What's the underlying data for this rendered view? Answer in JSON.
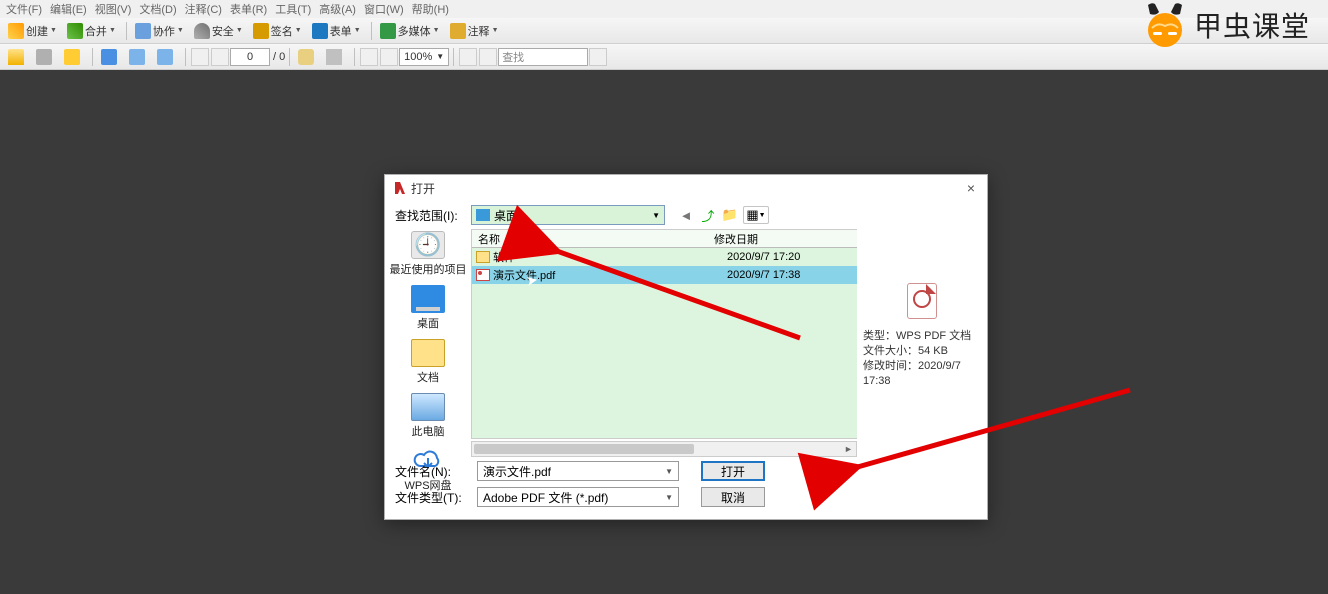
{
  "menu": {
    "file": "文件(F)",
    "edit": "编辑(E)",
    "view": "视图(V)",
    "document": "文档(D)",
    "comment": "注释(C)",
    "table": "表单(R)",
    "tool": "工具(T)",
    "advanced": "高级(A)",
    "window": "窗口(W)",
    "help": "帮助(H)"
  },
  "toolbar1": {
    "create": "创建",
    "merge": "合并",
    "collab": "协作",
    "secure": "安全",
    "sign": "签名",
    "form": "表单",
    "media": "多媒体",
    "comment": "注释"
  },
  "toolbar2": {
    "page_current": "0",
    "page_sep": "/",
    "page_total": "0",
    "zoom": "100%",
    "find": "查找"
  },
  "logo": {
    "text": "甲虫课堂"
  },
  "dialog": {
    "title": "打开",
    "scope_label": "查找范围(I):",
    "scope_value": "桌面",
    "header_name": "名称",
    "header_date": "修改日期",
    "rows": [
      {
        "name": "软件",
        "date": "2020/9/7 17:20",
        "type": "folder"
      },
      {
        "name": "演示文件.pdf",
        "date": "2020/9/7 17:38",
        "type": "pdf",
        "selected": true
      }
    ],
    "sidebar": {
      "recent": "最近使用的项目",
      "desktop": "桌面",
      "docs": "文档",
      "pc": "此电脑",
      "wps": "WPS网盘"
    },
    "preview": {
      "type_line": "类型：WPS PDF 文档",
      "size_line": "文件大小：54 KB",
      "date_line": "修改时间：2020/9/7 17:38"
    },
    "filename_label": "文件名(N):",
    "filename_value": "演示文件.pdf",
    "filetype_label": "文件类型(T):",
    "filetype_value": "Adobe PDF 文件 (*.pdf)",
    "open_btn": "打开",
    "cancel_btn": "取消"
  }
}
